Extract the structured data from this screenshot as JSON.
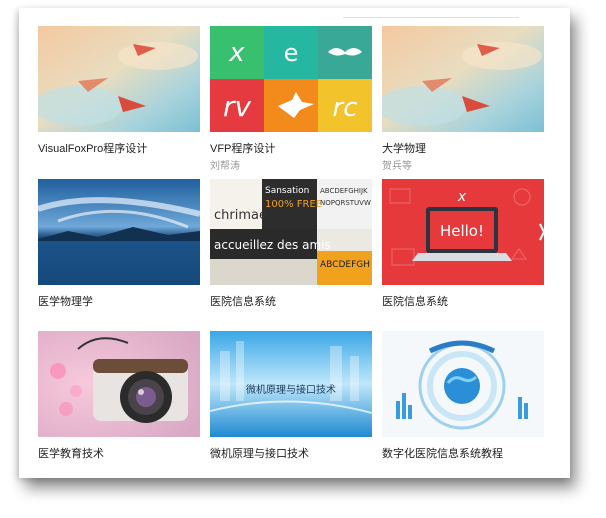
{
  "courses": [
    {
      "title": "VisualFoxPro程序设计",
      "author": "",
      "thumb": "paper-planes-sky",
      "thumb_text": ""
    },
    {
      "title": "VFP程序设计",
      "author": "刘帮涛",
      "thumb": "color-logo-tiles",
      "thumb_text": ""
    },
    {
      "title": "大学物理",
      "author": "贺兵等",
      "thumb": "paper-planes-sky",
      "thumb_text": ""
    },
    {
      "title": "医学物理学",
      "author": "",
      "thumb": "lake-clouds",
      "thumb_text": ""
    },
    {
      "title": "医院信息系统",
      "author": "",
      "thumb": "typography-collage",
      "thumb_text": ""
    },
    {
      "title": "医院信息系统",
      "author": "",
      "thumb": "laptop-hello",
      "thumb_text": "Hello!"
    },
    {
      "title": "医学教育技术",
      "author": "",
      "thumb": "camera-bokeh",
      "thumb_text": ""
    },
    {
      "title": "微机原理与接口技术",
      "author": "",
      "thumb": "blue-tech-city",
      "thumb_text": "微机原理与接口技术"
    },
    {
      "title": "数字化医院信息系统教程",
      "author": "",
      "thumb": "globe-tech",
      "thumb_text": ""
    }
  ],
  "colors": {
    "title": "#222222",
    "author": "#999999",
    "accent_red": "#e6393d"
  }
}
